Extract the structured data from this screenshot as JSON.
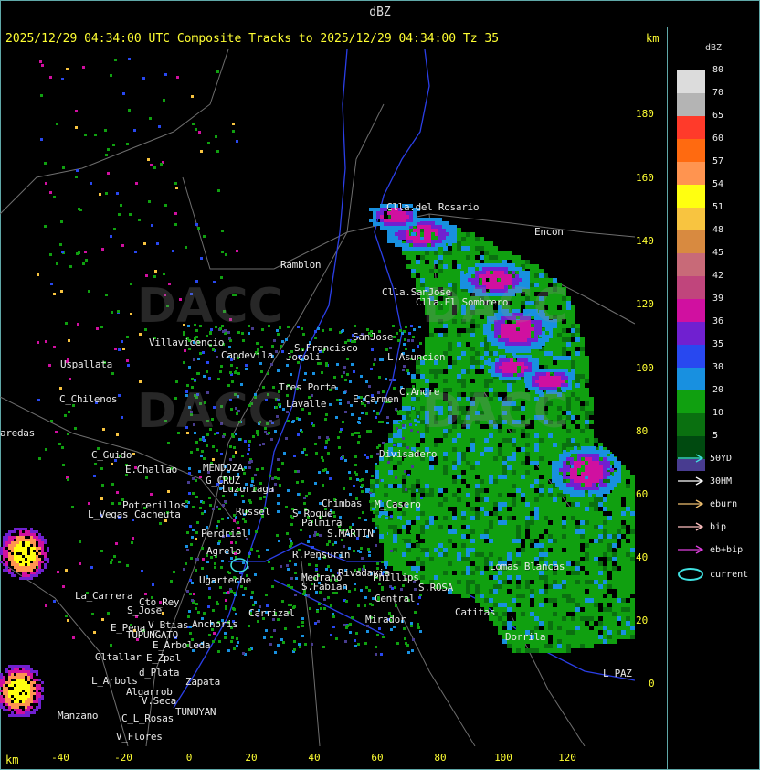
{
  "top_title": "dBZ",
  "header": "2025/12/29 04:34:00 UTC Composite Tracks to 2025/12/29 04:34:00 Tz 35",
  "km_label": "km",
  "y_ticks": [
    "180",
    "160",
    "140",
    "120",
    "100",
    "80",
    "60",
    "40",
    "20",
    "0"
  ],
  "x_ticks": [
    "-40",
    "-20",
    "0",
    "20",
    "40",
    "60",
    "80",
    "100",
    "120"
  ],
  "legend": {
    "title": "dBZ",
    "levels": [
      {
        "label": "80",
        "color": "#dcdcdc"
      },
      {
        "label": "70",
        "color": "#b4b4b4"
      },
      {
        "label": "65",
        "color": "#ff3a2a"
      },
      {
        "label": "60",
        "color": "#ff6a10"
      },
      {
        "label": "57",
        "color": "#ff9450"
      },
      {
        "label": "54",
        "color": "#ffff10"
      },
      {
        "label": "51",
        "color": "#f8c440"
      },
      {
        "label": "48",
        "color": "#d88a40"
      },
      {
        "label": "45",
        "color": "#c86a78"
      },
      {
        "label": "42",
        "color": "#c0457c"
      },
      {
        "label": "39",
        "color": "#d010a0"
      },
      {
        "label": "36",
        "color": "#7020d0"
      },
      {
        "label": "35",
        "color": "#2848f0"
      },
      {
        "label": "30",
        "color": "#1890e0"
      },
      {
        "label": "20",
        "color": "#10a010"
      },
      {
        "label": "10",
        "color": "#0a7010"
      },
      {
        "label": "5",
        "color": "#004a10"
      },
      {
        "label": "",
        "color": "#483c90"
      }
    ],
    "tracks": [
      {
        "label": "50YD",
        "color": "#40e0e0",
        "type": "arrow"
      },
      {
        "label": "30HM",
        "color": "#ffffff",
        "type": "arrow"
      },
      {
        "label": "eburn",
        "color": "#f0c070",
        "type": "arrow"
      },
      {
        "label": "bip",
        "color": "#ffc0c0",
        "type": "arrow"
      },
      {
        "label": "eb+bip",
        "color": "#e040e0",
        "type": "arrow"
      },
      {
        "label": "current",
        "color": "#40e0e0",
        "type": "ellipse"
      }
    ]
  },
  "watermark": "DACC",
  "places": [
    {
      "name": "Clla.del Rosario"
    },
    {
      "name": "Encon"
    },
    {
      "name": "Ramblon"
    },
    {
      "name": "Clla.SanJose"
    },
    {
      "name": "Clla.El Sombrero"
    },
    {
      "name": "Villavicencio"
    },
    {
      "name": "Capdevila"
    },
    {
      "name": "S.Francisco"
    },
    {
      "name": "SanJose"
    },
    {
      "name": "L.Asuncion"
    },
    {
      "name": "Uspallata"
    },
    {
      "name": "Jocoli"
    },
    {
      "name": "Tres Porte"
    },
    {
      "name": "C.Andre"
    },
    {
      "name": "C_Chilenos"
    },
    {
      "name": "Lavalle"
    },
    {
      "name": "E.Carmen"
    },
    {
      "name": "aredas"
    },
    {
      "name": "C_Guido"
    },
    {
      "name": "Divisadero"
    },
    {
      "name": "E.Challao"
    },
    {
      "name": "MENDOZA"
    },
    {
      "name": "G_CRUZ"
    },
    {
      "name": "Luzuriaga"
    },
    {
      "name": "Potrerillos"
    },
    {
      "name": "L_Vegas"
    },
    {
      "name": "Cacheuta"
    },
    {
      "name": "Russel"
    },
    {
      "name": "S_Roque"
    },
    {
      "name": "Chimbas"
    },
    {
      "name": "M_Casero"
    },
    {
      "name": "Perdriel"
    },
    {
      "name": "Agrelo"
    },
    {
      "name": "S.MARTIN"
    },
    {
      "name": "R.Pensurin"
    },
    {
      "name": "Lomas_Blancas"
    },
    {
      "name": "La_Carrera"
    },
    {
      "name": "Cto_Rey"
    },
    {
      "name": "S_Jose"
    },
    {
      "name": "Ugarteche"
    },
    {
      "name": "Carrizal"
    },
    {
      "name": "E_Pena"
    },
    {
      "name": "V_Btias"
    },
    {
      "name": "TUPUNGATO"
    },
    {
      "name": "Anchoris"
    },
    {
      "name": "Central"
    },
    {
      "name": "Mirador"
    },
    {
      "name": "Catitas"
    },
    {
      "name": "Dorrila"
    },
    {
      "name": "E_Arboleda"
    },
    {
      "name": "Gltallar"
    },
    {
      "name": "E_Zpal"
    },
    {
      "name": "L_Arbols"
    },
    {
      "name": "d_Plata"
    },
    {
      "name": "Zapata"
    },
    {
      "name": "L_PAZ"
    },
    {
      "name": "Algarrob"
    },
    {
      "name": "V.Seca"
    },
    {
      "name": "TUNUYAN"
    },
    {
      "name": "Manzano"
    },
    {
      "name": "C_L_Rosas"
    },
    {
      "name": "V_Flores"
    },
    {
      "name": "Medrano"
    },
    {
      "name": "Rivadavia"
    },
    {
      "name": "S.ROSA"
    },
    {
      "name": "Palmira"
    },
    {
      "name": "Phillips"
    },
    {
      "name": "S.Fabian"
    }
  ]
}
